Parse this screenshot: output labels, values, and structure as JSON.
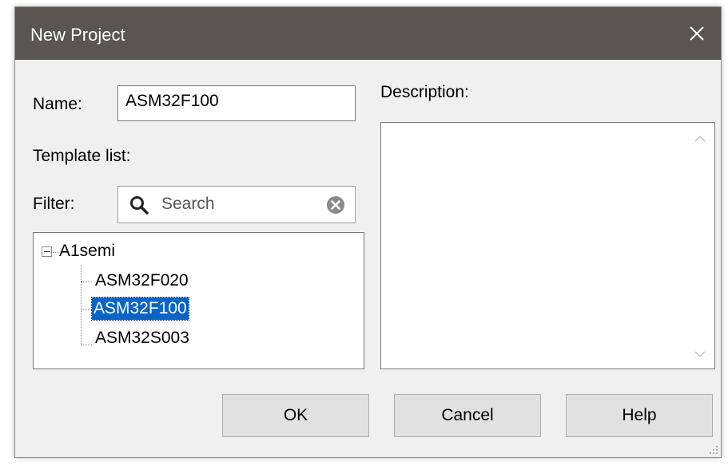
{
  "dialog": {
    "title": "New Project",
    "close_icon": "close-icon"
  },
  "form": {
    "name_label": "Name:",
    "name_value": "ASM32F100",
    "template_list_label": "Template list:",
    "filter_label": "Filter:",
    "search_placeholder": "Search",
    "description_label": "Description:"
  },
  "tree": {
    "root": "A1semi",
    "root_expanded": true,
    "items": [
      "ASM32F020",
      "ASM32F100",
      "ASM32S003"
    ],
    "selected": "ASM32F100"
  },
  "buttons": {
    "ok": "OK",
    "cancel": "Cancel",
    "help": "Help"
  },
  "colors": {
    "titlebar": "#5a5553",
    "selection": "#0a64c8",
    "dialog_bg": "#f0f0f0"
  }
}
